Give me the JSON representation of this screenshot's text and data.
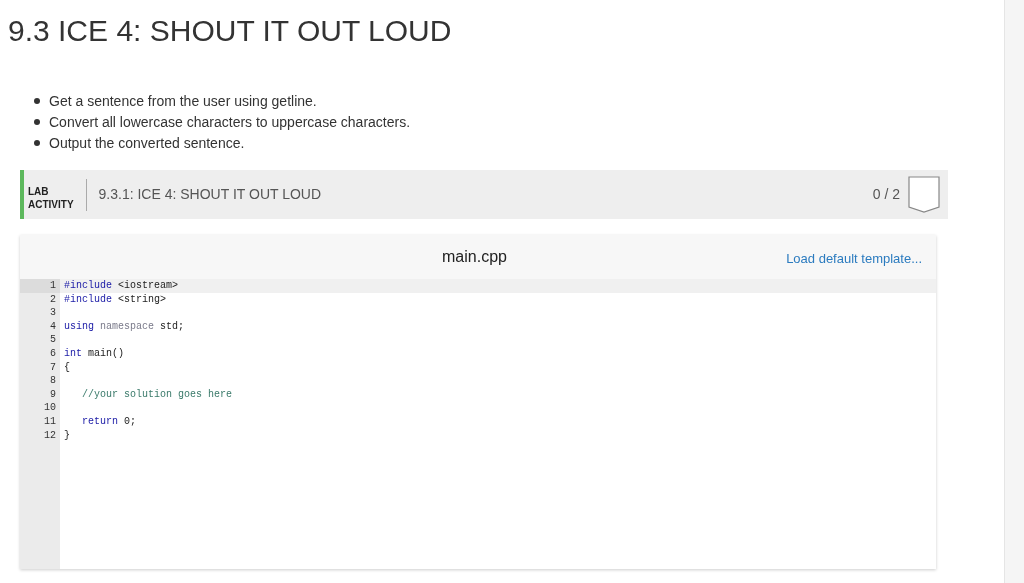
{
  "title": "9.3 ICE 4: SHOUT IT OUT LOUD",
  "bullets": [
    "Get a sentence from the user using getline.",
    "Convert all lowercase characters to uppercase characters.",
    "Output the converted sentence."
  ],
  "lab": {
    "label_lines": [
      "LAB",
      "ACTIVITY"
    ],
    "name": "9.3.1: ICE 4: SHOUT IT OUT LOUD",
    "score": "0 / 2"
  },
  "editor": {
    "filename": "main.cpp",
    "template_link": "Load default template...",
    "lines": [
      {
        "number": "1",
        "selected": true,
        "tokens": [
          {
            "kind": "keyword",
            "text": "#include"
          },
          {
            "kind": "plain",
            "text": " <iostream>"
          }
        ]
      },
      {
        "number": "2",
        "selected": false,
        "tokens": [
          {
            "kind": "keyword",
            "text": "#include"
          },
          {
            "kind": "plain",
            "text": " <string>"
          }
        ]
      },
      {
        "number": "3",
        "selected": false
      },
      {
        "number": "4",
        "selected": false,
        "tokens": [
          {
            "kind": "keyword",
            "text": "using"
          },
          {
            "kind": "muted",
            "text": " namespace"
          },
          {
            "kind": "plain",
            "text": " std;"
          }
        ]
      },
      {
        "number": "5",
        "selected": false
      },
      {
        "number": "6",
        "selected": false,
        "tokens": [
          {
            "kind": "keyword",
            "text": "int"
          },
          {
            "kind": "plain",
            "text": " main()"
          }
        ]
      },
      {
        "number": "7",
        "selected": false,
        "tokens": [
          {
            "kind": "plain",
            "text": "{"
          }
        ]
      },
      {
        "number": "8",
        "selected": false
      },
      {
        "number": "9",
        "selected": false,
        "tokens": [
          {
            "kind": "comment",
            "text": "   //your solution goes here"
          }
        ]
      },
      {
        "number": "10",
        "selected": false
      },
      {
        "number": "11",
        "selected": false,
        "tokens": [
          {
            "kind": "keyword",
            "text": "   return"
          },
          {
            "kind": "plain",
            "text": " 0;"
          }
        ]
      },
      {
        "number": "12",
        "selected": false,
        "tokens": [
          {
            "kind": "plain",
            "text": "}"
          }
        ]
      }
    ]
  }
}
